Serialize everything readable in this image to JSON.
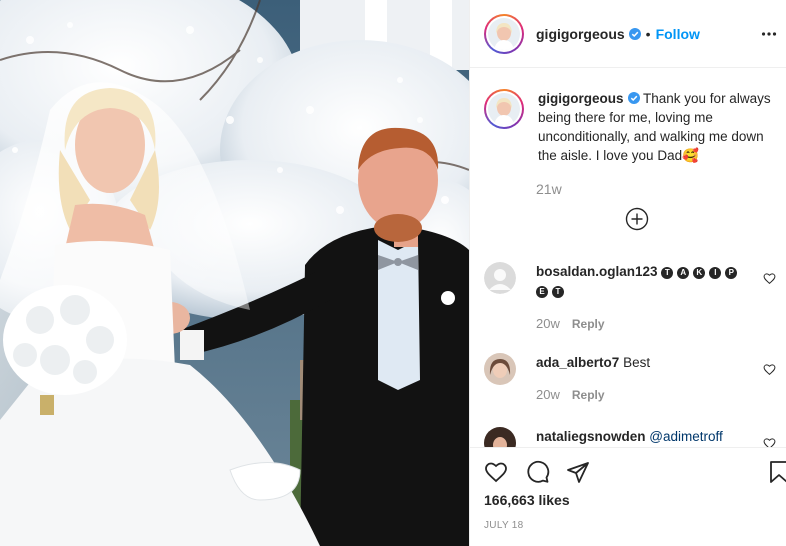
{
  "post": {
    "author": "gigigorgeous",
    "follow_label": "Follow",
    "dot": "•",
    "caption_text": "Thank you for always being there for me, loving me unconditionally, and walking me down the aisle. I love you Dad🥰",
    "caption_time": "21w",
    "likes": "166,663 likes",
    "date": "JULY 18"
  },
  "comments": [
    {
      "user": "bosaldan.oglan123",
      "badges": [
        "T",
        "A",
        "K",
        "I",
        "P",
        "E",
        "T"
      ],
      "text": "",
      "time": "20w",
      "reply": "Reply"
    },
    {
      "user": "ada_alberto7",
      "badges": [],
      "text": "Best",
      "time": "20w",
      "reply": "Reply"
    },
    {
      "user": "nataliegsnowden",
      "badges": [],
      "text": "@adimetroff",
      "time": "",
      "reply": ""
    }
  ],
  "colors": {
    "link_blue": "#0095f6",
    "verified_blue": "#3897f0",
    "muted_gray": "#8e8e8e",
    "text_dark": "#262626"
  },
  "icons": [
    "verified-icon",
    "more-options-icon",
    "load-more-comments-icon",
    "heart-icon",
    "comment-icon",
    "share-icon",
    "bookmark-icon"
  ]
}
